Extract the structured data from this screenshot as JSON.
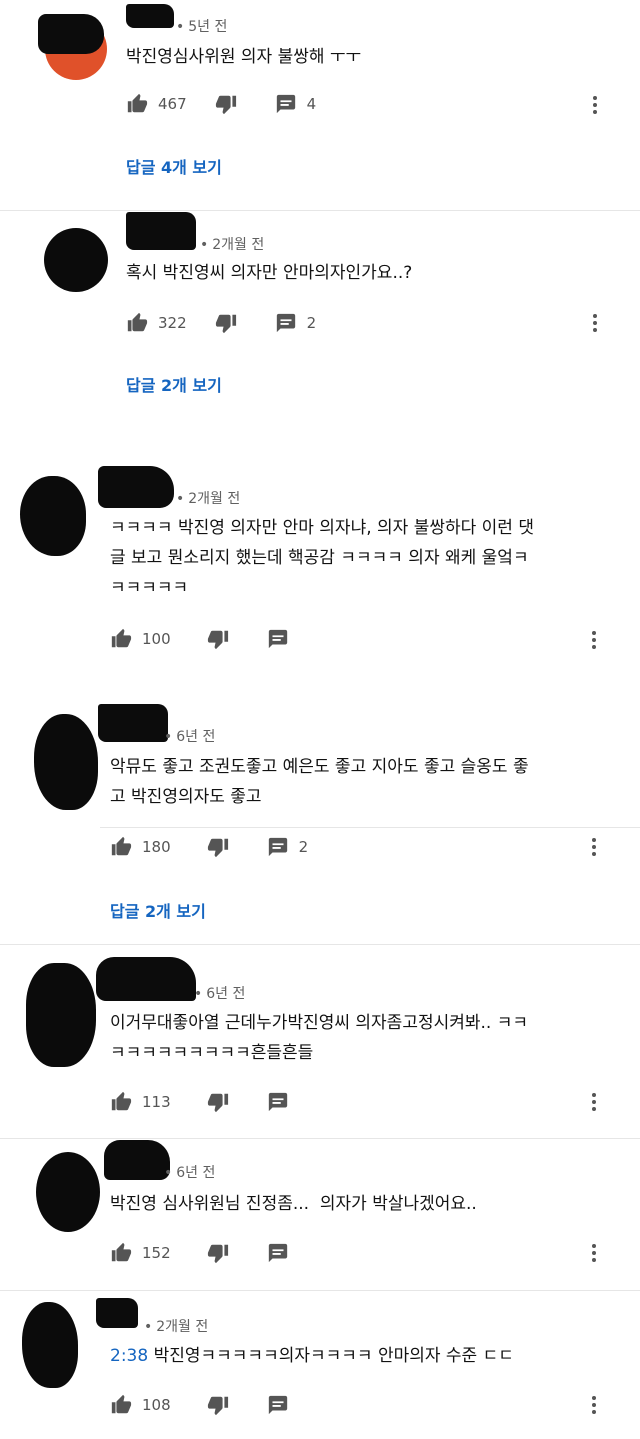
{
  "comments": [
    {
      "time": "5년 전",
      "text": "박진영심사위원 의자 불쌍해 ㅜㅜ",
      "likes": "467",
      "replies_count": "4",
      "view_replies": "답글 4개 보기",
      "avatar_color": "#e0512a"
    },
    {
      "time": "2개월 전",
      "text": "혹시 박진영씨 의자만 안마의자인가요..?",
      "likes": "322",
      "replies_count": "2",
      "view_replies": "답글 2개 보기",
      "avatar_color": "#0b0b0b"
    },
    {
      "time": "2개월 전",
      "text": "ㅋㅋㅋㅋ 박진영 의자만 안마 의자냐, 의자 불쌍하다 이런 댓\n글 보고 뭔소리지 했는데 핵공감 ㅋㅋㅋㅋ 의자 왜케 울엌ㅋ\nㅋㅋㅋㅋㅋ",
      "likes": "100",
      "replies_count": "",
      "view_replies": ""
    },
    {
      "time": "6년 전",
      "text": "악뮤도 좋고 조권도좋고 예은도 좋고 지아도 좋고 슬옹도 좋\n고 박진영의자도 좋고",
      "likes": "180",
      "replies_count": "2",
      "view_replies": "답글 2개 보기"
    },
    {
      "time": "6년 전",
      "text": "이거무대좋아열 근데누가박진영씨 의자좀고정시켜봐.. ㅋㅋ\nㅋㅋㅋㅋㅋㅋㅋㅋㅋ흔들흔들",
      "likes": "113",
      "replies_count": "",
      "view_replies": ""
    },
    {
      "time": "6년 전",
      "text": "박진영 심사위원님 진정좀...  의자가 박살나겠어요..",
      "likes": "152",
      "replies_count": "",
      "view_replies": ""
    },
    {
      "time": "2개월 전",
      "timestamp": "2:38",
      "text": " 박진영ㅋㅋㅋㅋㅋ의자ㅋㅋㅋㅋ 안마의자 수준 ㄷㄷ",
      "likes": "108",
      "replies_count": "",
      "view_replies": ""
    }
  ]
}
